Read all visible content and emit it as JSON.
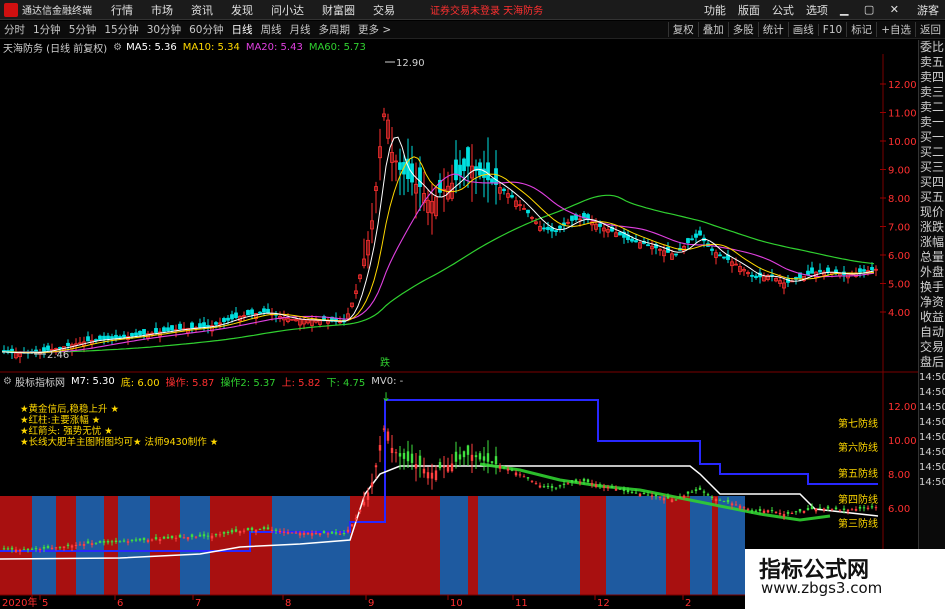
{
  "app": {
    "title": "通达信金融终端",
    "alert": "证券交易未登录  天海防务",
    "browse": "游客"
  },
  "menu": [
    "行情",
    "市场",
    "资讯",
    "发现",
    "问小达",
    "财富圈",
    "交易"
  ],
  "menu_right": [
    "功能",
    "版面",
    "公式",
    "选项"
  ],
  "toolbar": {
    "periods": [
      "分时",
      "1分钟",
      "5分钟",
      "15分钟",
      "30分钟",
      "60分钟",
      "日线",
      "周线",
      "月线",
      "多周期",
      "更多 >"
    ],
    "active": "日线",
    "right": [
      "复权",
      "叠加",
      "多股",
      "统计",
      "画线",
      "F10",
      "标记",
      "+自选",
      "返回"
    ]
  },
  "main_info": {
    "name": "天海防务 (日线 前复权)",
    "ma5": "MA5: 5.36",
    "ma10": "MA10: 5.34",
    "ma20": "MA20: 5.43",
    "ma60": "MA60: 5.73"
  },
  "main_axis": [
    "12.00",
    "11.00",
    "10.00",
    "9.00",
    "8.00",
    "7.00",
    "6.00",
    "5.00",
    "4.00"
  ],
  "annotations": {
    "high": "12.90",
    "low": "2.46",
    "signal": "跌"
  },
  "sub_info": {
    "name": "股标指标网",
    "m7": "M7: 5.30",
    "bot": "底: 6.00",
    "op": "操作: 5.87",
    "op2": "操作2: 5.37",
    "up": "上: 5.82",
    "down": "下: 4.75",
    "mv": "MV0: -"
  },
  "sub_axis": [
    "12.00",
    "10.00",
    "8.00",
    "6.00"
  ],
  "sub_notes": [
    "★黄金信后,稳稳上升 ★",
    "★红柱:主要涨幅 ★",
    "★红箭头: 强势无忧 ★",
    "★长线大肥羊主图附图均可★  法师9430制作 ★"
  ],
  "defense_lines": [
    "第七防线",
    "第六防线",
    "第五防线",
    "第四防线",
    "第三防线"
  ],
  "date_axis": [
    "2020年",
    "5",
    "6",
    "7",
    "8",
    "9",
    "10",
    "11",
    "12",
    "2"
  ],
  "right_panel": [
    "委比",
    "卖五",
    "卖四",
    "卖三",
    "卖二",
    "卖一",
    "买一",
    "买二",
    "买三",
    "买四",
    "买五",
    "现价",
    "涨跌",
    "涨幅",
    "总量",
    "外盘",
    "换手",
    "净资",
    "收益",
    "自动",
    "交易",
    "盘后",
    "14:50",
    "14:50",
    "14:50",
    "14:50",
    "14:50",
    "14:50",
    "14:50",
    "14:50"
  ],
  "watermark": {
    "title": "指标公式网",
    "url": "www.zbgs3.com"
  },
  "colors": {
    "up": "#ff3030",
    "down": "#00e0e0",
    "ma5": "#ffffff",
    "ma10": "#ffd800",
    "ma20": "#e040e0",
    "ma60": "#30d030",
    "blue_block": "#1e5aa0",
    "red_block": "#b01414",
    "defense": "#3030ff"
  }
}
